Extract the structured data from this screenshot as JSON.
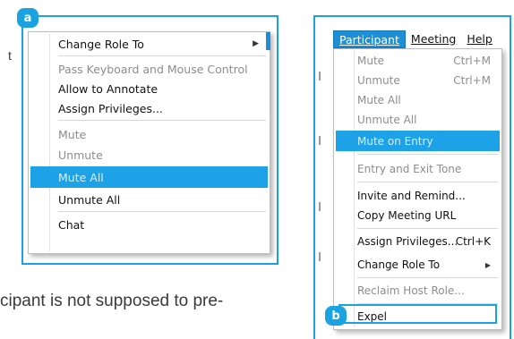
{
  "background": {
    "colon_text": "t",
    "paragraph_fragment": "cipant is not supposed to pre-"
  },
  "badges": {
    "a": "a",
    "b": "b"
  },
  "menu_a": {
    "items": [
      {
        "label": "Change Role To",
        "state": "normal",
        "submenu": true
      },
      {
        "label": "Pass Keyboard and Mouse Control",
        "state": "disabled"
      },
      {
        "label": "Allow to Annotate",
        "state": "normal"
      },
      {
        "label": "Assign Privileges...",
        "state": "normal"
      },
      {
        "label": "Mute",
        "state": "disabled"
      },
      {
        "label": "Unmute",
        "state": "disabled"
      },
      {
        "label": "Mute All",
        "state": "highlighted"
      },
      {
        "label": "Unmute All",
        "state": "normal"
      },
      {
        "label": "Chat",
        "state": "normal"
      }
    ],
    "submenu_arrow": "▶"
  },
  "menu_b": {
    "menubar": [
      "Participant",
      "Meeting",
      "Help"
    ],
    "items": [
      {
        "label": "Mute",
        "shortcut": "Ctrl+M",
        "state": "disabled"
      },
      {
        "label": "Unmute",
        "shortcut": "Ctrl+M",
        "state": "disabled"
      },
      {
        "label": "Mute All",
        "shortcut": "",
        "state": "disabled"
      },
      {
        "label": "Unmute All",
        "shortcut": "",
        "state": "disabled"
      },
      {
        "label": "Mute on Entry",
        "shortcut": "",
        "state": "highlighted"
      },
      {
        "label": "Entry and Exit Tone",
        "shortcut": "",
        "state": "disabled"
      },
      {
        "label": "Invite and Remind...",
        "shortcut": "",
        "state": "normal"
      },
      {
        "label": "Copy Meeting URL",
        "shortcut": "",
        "state": "normal"
      },
      {
        "label": "Assign Privileges...",
        "shortcut": "Ctrl+K",
        "state": "normal"
      },
      {
        "label": "Change Role To",
        "shortcut": "",
        "state": "normal",
        "submenu": true
      },
      {
        "label": "Reclaim Host Role...",
        "shortcut": "",
        "state": "disabled"
      },
      {
        "label": "Expel",
        "shortcut": "",
        "state": "normal"
      }
    ],
    "submenu_arrow": "▶"
  },
  "colors": {
    "accent": "#1aa3e0",
    "highlight": "#1da2e8",
    "menubar_active": "#1d8fd6"
  }
}
